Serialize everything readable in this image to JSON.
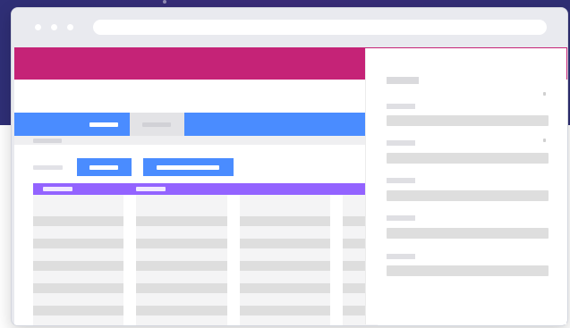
{
  "background": {
    "top_color": "#2f2f76",
    "bottom_color": "#ffffff"
  },
  "window": {
    "chrome_color": "#e9eaef",
    "content_bg": "#ffffff",
    "header_color": "#c52377",
    "tab_color": "#4a8cff",
    "action_color": "#4a8cff",
    "purple_color": "#9363ff",
    "panel_color": "#ffffff",
    "placeholder_color": "#dedede"
  },
  "icons": {
    "traffic_lights": [
      "circle-icon",
      "circle-icon",
      "circle-icon"
    ]
  }
}
